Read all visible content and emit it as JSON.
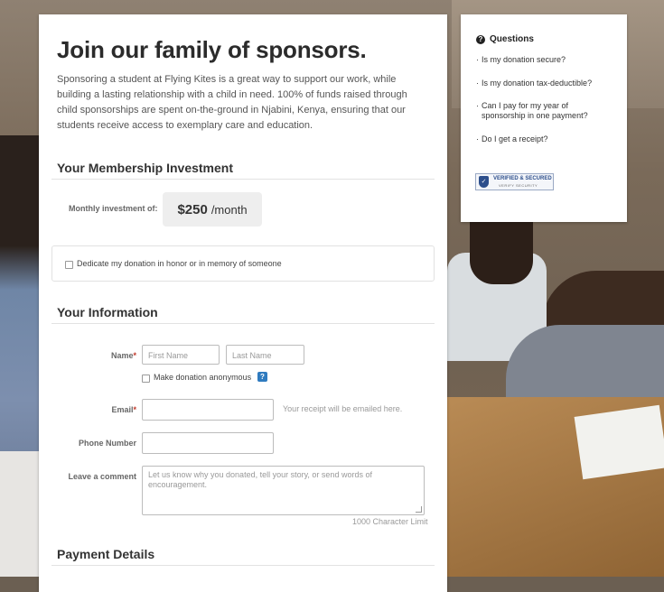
{
  "page": {
    "title": "Join our family of sponsors.",
    "intro": "Sponsoring a student at Flying Kites is a great way to support our work, while building a lasting relationship with a child in need. 100% of funds raised through child sponsorships are spent on-the-ground in Njabini, Kenya, ensuring that our students receive access to exemplary care and education."
  },
  "membership": {
    "heading": "Your Membership Investment",
    "label": "Monthly investment of:",
    "amount": "$250",
    "period": "/month"
  },
  "dedicate": {
    "label": "Dedicate my donation in honor or in memory of someone"
  },
  "info": {
    "heading": "Your Information",
    "name_label": "Name",
    "required_mark": "*",
    "first_placeholder": "First Name",
    "last_placeholder": "Last Name",
    "anonymous_label": "Make donation anonymous",
    "help_badge": "?",
    "email_label": "Email",
    "email_hint": "Your receipt will be emailed here.",
    "phone_label": "Phone Number",
    "comment_label": "Leave a comment",
    "comment_placeholder": "Let us know why you donated, tell your story, or send words of encouragement.",
    "char_limit": "1000 Character Limit"
  },
  "payment": {
    "heading": "Payment Details"
  },
  "sidebar": {
    "heading": "Questions",
    "icon": "?",
    "faqs": [
      "Is my donation secure?",
      "Is my donation tax-deductible?",
      "Can I pay for my year of sponsorship in one payment?",
      "Do I get a receipt?"
    ],
    "seal_line1": "VERIFIED & SECURED",
    "seal_line2": "VERIFY SECURITY"
  }
}
